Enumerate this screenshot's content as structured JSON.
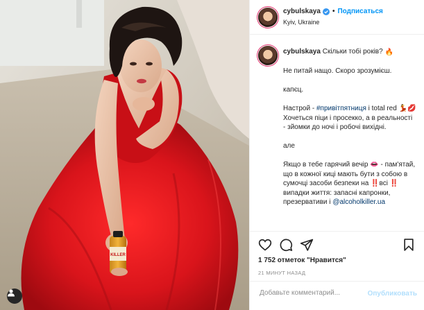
{
  "post": {
    "username": "cybulskaya",
    "follow_label": "Подписаться",
    "location": "Kyiv, Ukraine",
    "caption_question": "Скільки тобі років?",
    "caption_lines": [
      "Не питай нащо. Скоро зрозумієш.",
      "капєц.",
      "Настрой - ",
      "Хочеться піци і просекко, а в реальності - зйомки до ночі і робочі вихідні.",
      "але",
      "Якщо в тебе гарячий вечір 👄 - пам'ятай, що в кожної киці мають бути з собою в сумочці засоби безпеки на ‼️всі ‼️випадки життя: запасні капронки, презервативи і "
    ],
    "hashtag": "#привітпятниця",
    "mood_suffix": " і total red 💃💋",
    "mention": "@alcoholkiller.ua",
    "likes_text": "1 752 отметок \"Нравится\"",
    "time_ago": "21 МИНУТ НАЗАД",
    "comment_placeholder": "Добавьте комментарий...",
    "publish_label": "Опубликовать",
    "bottle_label": "KILLER"
  },
  "icons": [
    "heart-icon",
    "comment-icon",
    "share-icon",
    "bookmark-icon",
    "verified-icon",
    "user-tag-icon",
    "emoji-fire-icon"
  ],
  "colors": {
    "accent": "#0095f6",
    "text": "#262626",
    "muted": "#8e8e8e",
    "dress": "#d7141a",
    "publish_disabled": "#b2dffc"
  }
}
